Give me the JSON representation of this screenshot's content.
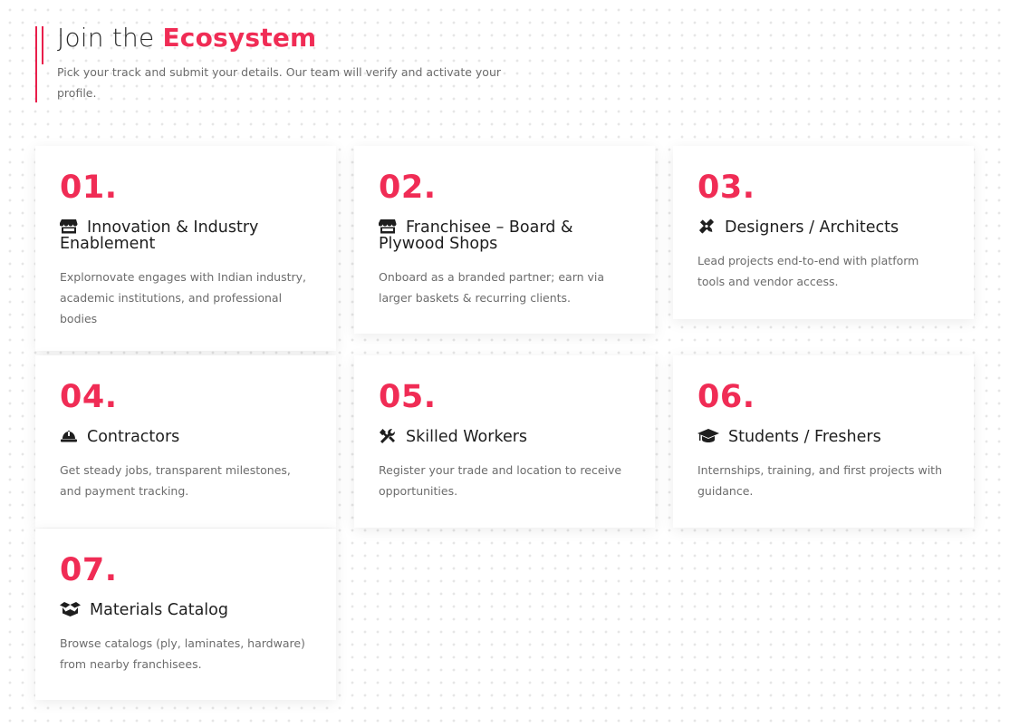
{
  "header": {
    "title_prefix": "Join the",
    "title_accent": "Ecosystem",
    "subtitle": "Pick your track and submit your details. Our team will verify and activate your profile."
  },
  "colors": {
    "accent": "#f02c55",
    "text": "#1e1e1e",
    "muted": "#6c6c6c"
  },
  "cards": [
    {
      "number": "01.",
      "icon": "store-icon",
      "title": "Innovation & Industry Enablement",
      "description": "Explornovate engages with Indian industry, academic institutions, and professional bodies"
    },
    {
      "number": "02.",
      "icon": "store-icon",
      "title": "Franchisee – Board & Plywood Shops",
      "description": "Onboard as a branded partner; earn via larger baskets & recurring clients."
    },
    {
      "number": "03.",
      "icon": "pencil-ruler-icon",
      "title": "Designers / Architects",
      "description": "Lead projects end-to-end with platform tools and vendor access."
    },
    {
      "number": "04.",
      "icon": "hard-hat-icon",
      "title": "Contractors",
      "description": "Get steady jobs, transparent milestones, and payment tracking."
    },
    {
      "number": "05.",
      "icon": "tools-icon",
      "title": "Skilled Workers",
      "description": "Register your trade and location to receive opportunities."
    },
    {
      "number": "06.",
      "icon": "graduation-cap-icon",
      "title": "Students / Freshers",
      "description": "Internships, training, and first projects with guidance."
    },
    {
      "number": "07.",
      "icon": "box-open-icon",
      "title": "Materials Catalog",
      "description": "Browse catalogs (ply, laminates, hardware) from nearby franchisees."
    }
  ]
}
